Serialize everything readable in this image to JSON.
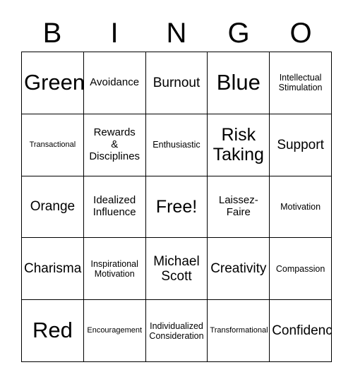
{
  "card": {
    "title": "BINGO",
    "header_letters": [
      "B",
      "I",
      "N",
      "G",
      "O"
    ],
    "columns": 5,
    "rows": 5,
    "border_color": "#000000",
    "background_color": "#ffffff",
    "text_color": "#000000",
    "free_space": "Free!",
    "free_space_position": {
      "row": 3,
      "column": 3
    },
    "cells": [
      {
        "text": "Green",
        "size": "xl"
      },
      {
        "text": "Avoidance",
        "size": "sm"
      },
      {
        "text": "Burnout",
        "size": "md"
      },
      {
        "text": "Blue",
        "size": "xl"
      },
      {
        "text": "Intellectual\nStimulation",
        "size": "xs"
      },
      {
        "text": "Transactional",
        "size": "xxs"
      },
      {
        "text": "Rewards\n&\nDisciplines",
        "size": "sm"
      },
      {
        "text": "Enthusiastic",
        "size": "xs"
      },
      {
        "text": "Risk\nTaking",
        "size": "lg"
      },
      {
        "text": "Support",
        "size": "md"
      },
      {
        "text": "Orange",
        "size": "md"
      },
      {
        "text": "Idealized\nInfluence",
        "size": "sm"
      },
      {
        "text": "Free!",
        "size": "lg"
      },
      {
        "text": "Laissez-\nFaire",
        "size": "sm"
      },
      {
        "text": "Motivation",
        "size": "xs"
      },
      {
        "text": "Charisma",
        "size": "md"
      },
      {
        "text": "Inspirational\nMotivation",
        "size": "xs"
      },
      {
        "text": "Michael\nScott",
        "size": "md"
      },
      {
        "text": "Creativity",
        "size": "md"
      },
      {
        "text": "Compassion",
        "size": "xs"
      },
      {
        "text": "Red",
        "size": "xl"
      },
      {
        "text": "Encouragement",
        "size": "xxs"
      },
      {
        "text": "Individualized\nConsideration",
        "size": "xs"
      },
      {
        "text": "Transformational",
        "size": "xxs"
      },
      {
        "text": "Confidence",
        "size": "md"
      }
    ]
  }
}
